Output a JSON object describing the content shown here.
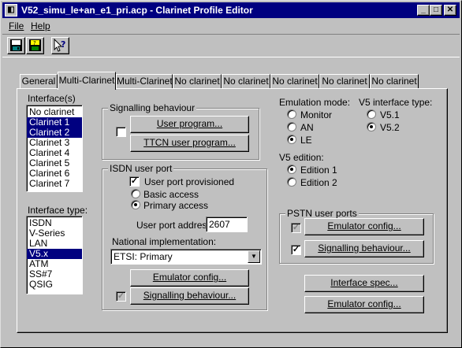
{
  "window": {
    "title": "V52_simu_le+an_e1_pri.acp - Clarinet Profile Editor",
    "title_icon": "app-icon",
    "minimize": "_",
    "maximize": "□",
    "close": "✕"
  },
  "menu": {
    "file": "File",
    "help": "Help"
  },
  "toolbar": {
    "icons": [
      "save-icon",
      "save-all-icon",
      "context-help-icon"
    ]
  },
  "tabs": [
    "General",
    "Multi-Clarinet",
    "Multi-Clarinet",
    "No clarinet",
    "No clarinet",
    "No clarinet",
    "No clarinet",
    "No clarinet"
  ],
  "interfaces": {
    "label": "Interface(s)",
    "items": [
      "No clarinet",
      "Clarinet 1",
      "Clarinet 2",
      "Clarinet 3",
      "Clarinet 4",
      "Clarinet 5",
      "Clarinet 6",
      "Clarinet 7"
    ],
    "selected": [
      "Clarinet 1",
      "Clarinet 2"
    ]
  },
  "interface_type": {
    "label": "Interface type:",
    "items": [
      "ISDN",
      "V-Series",
      "LAN",
      "V5.x",
      "ATM",
      "SS#7",
      "QSIG"
    ],
    "selected": "V5.x"
  },
  "signalling": {
    "legend": "Signalling behaviour",
    "user_program": "User program...",
    "ttcn_user_program": "TTCN user program...",
    "checked": false
  },
  "isdn_user_port": {
    "legend": "ISDN user port",
    "provisioned_label": "User port provisioned",
    "provisioned": true,
    "basic_access": "Basic access",
    "primary_access": "Primary access",
    "access": "Primary access",
    "address_label": "User port address:",
    "address_value": "2607",
    "national_label": "National implementation:",
    "national_value": "ETSI: Primary",
    "emulator_config": "Emulator config...",
    "signalling_behaviour": "Signalling behaviour...",
    "signalling_checked": true
  },
  "emulation_mode": {
    "label": "Emulation mode:",
    "options": [
      "Monitor",
      "AN",
      "LE"
    ],
    "selected": "LE"
  },
  "v5_type": {
    "label": "V5 interface type:",
    "options": [
      "V5.1",
      "V5.2"
    ],
    "selected": "V5.2"
  },
  "v5_edition": {
    "label": "V5 edition:",
    "options": [
      "Edition 1",
      "Edition 2"
    ],
    "selected": "Edition 1"
  },
  "pstn": {
    "legend": "PSTN user ports",
    "emulator_config": "Emulator config...",
    "emulator_checked": true,
    "signalling_behaviour": "Signalling behaviour...",
    "signalling_checked": true
  },
  "bottom": {
    "interface_spec": "Interface spec...",
    "emulator_config": "Emulator config..."
  },
  "colors": {
    "titlebar": "#000080",
    "face": "#c0c0c0",
    "selection": "#000080"
  }
}
